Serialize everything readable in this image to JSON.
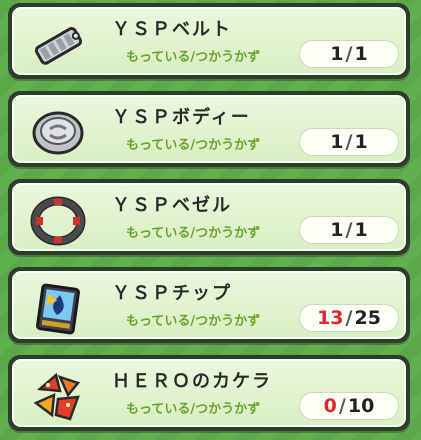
{
  "items": [
    {
      "name": "ＹＳＰベルト",
      "label": "もっている/つかうかず",
      "have": "1",
      "need": "1",
      "have_color": "#222222",
      "icon": "belt-icon"
    },
    {
      "name": "ＹＳＰボディー",
      "label": "もっている/つかうかず",
      "have": "1",
      "need": "1",
      "have_color": "#222222",
      "icon": "body-disc-icon"
    },
    {
      "name": "ＹＳＰベゼル",
      "label": "もっている/つかうかず",
      "have": "1",
      "need": "1",
      "have_color": "#222222",
      "icon": "bezel-ring-icon"
    },
    {
      "name": "ＹＳＰチップ",
      "label": "もっている/つかうかず",
      "have": "13",
      "need": "25",
      "have_color": "#e0262a",
      "icon": "chip-card-icon"
    },
    {
      "name": "ＨＥＲＯのカケラ",
      "label": "もっている/つかうかず",
      "have": "0",
      "need": "10",
      "have_color": "#e0262a",
      "icon": "hero-fragment-icon"
    }
  ],
  "separator": "/"
}
